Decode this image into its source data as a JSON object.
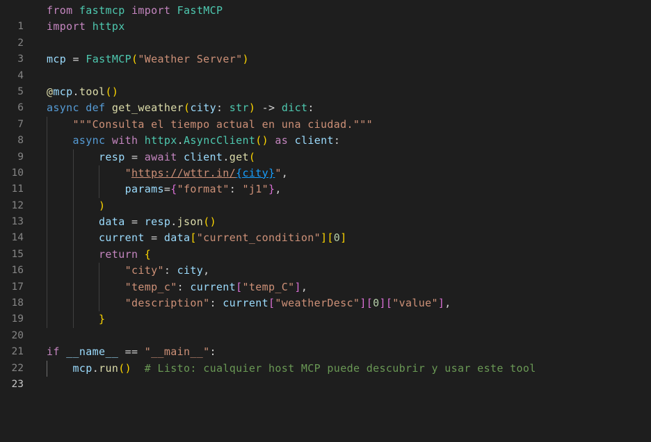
{
  "editor": {
    "language": "python",
    "theme": "dark",
    "active_line": 23,
    "lines": [
      {
        "n": "1"
      },
      {
        "n": "2"
      },
      {
        "n": "3"
      },
      {
        "n": "4"
      },
      {
        "n": "5"
      },
      {
        "n": "6"
      },
      {
        "n": "7"
      },
      {
        "n": "8"
      },
      {
        "n": "9"
      },
      {
        "n": "10"
      },
      {
        "n": "11"
      },
      {
        "n": "12"
      },
      {
        "n": "13"
      },
      {
        "n": "14"
      },
      {
        "n": "15"
      },
      {
        "n": "16"
      },
      {
        "n": "17"
      },
      {
        "n": "18"
      },
      {
        "n": "19"
      },
      {
        "n": "20"
      },
      {
        "n": "21"
      },
      {
        "n": "22"
      },
      {
        "n": "23"
      }
    ],
    "tokens": {
      "from": "from",
      "fastmcp": "fastmcp",
      "import": "import",
      "FastMCP": "FastMCP",
      "httpx": "httpx",
      "mcp": "mcp",
      "eq": " = ",
      "server_name": "\"Weather Server\"",
      "at": "@",
      "tool": "tool",
      "async": "async",
      "def": "def",
      "get_weather": "get_weather",
      "city": "city",
      "str": "str",
      "arrow": " -> ",
      "dict": "dict",
      "docstring": "\"\"\"Consulta el tiempo actual en una ciudad.\"\"\"",
      "with": "with",
      "AsyncClient": "AsyncClient",
      "as": "as",
      "client": "client",
      "resp": "resp",
      "await": "await",
      "get": "get",
      "url_q1": "\"",
      "url_text": "https://wttr.in/",
      "url_city": "{city}",
      "url_q2": "\"",
      "params": "params",
      "format_key": "\"format\"",
      "format_val": "\"j1\"",
      "data": "data",
      "json": "json",
      "current": "current",
      "current_condition": "\"current_condition\"",
      "zero": "0",
      "return": "return",
      "k_city": "\"city\"",
      "k_temp": "\"temp_c\"",
      "k_tempC": "\"temp_C\"",
      "k_desc": "\"description\"",
      "k_weatherDesc": "\"weatherDesc\"",
      "k_value": "\"value\"",
      "if": "if",
      "dunder_name": "__name__",
      "eqeq": " == ",
      "main_str": "\"__main__\"",
      "run": "run",
      "comment": "# Listo: cualquier host MCP puede descubrir y usar este tool"
    }
  }
}
